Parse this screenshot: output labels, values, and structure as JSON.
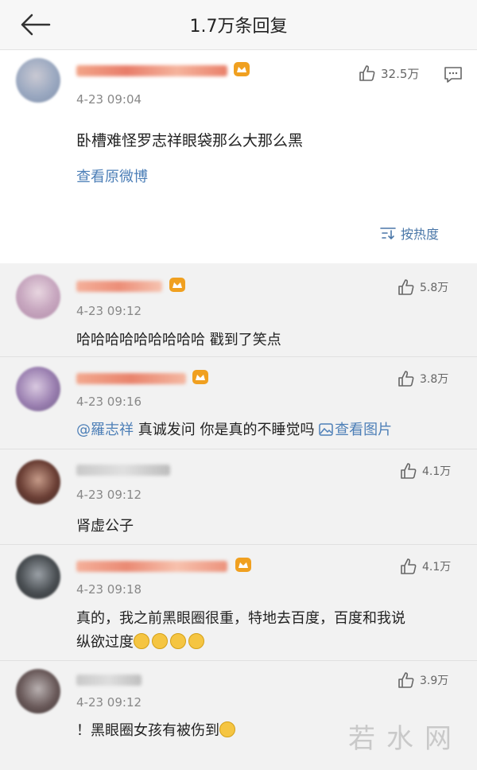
{
  "header": {
    "title": "1.7万条回复"
  },
  "main_comment": {
    "time": "4-23 09:04",
    "likes": "32.5万",
    "text": "卧槽难怪罗志祥眼袋那么大那么黑",
    "view_original": "查看原微博",
    "sort_label": "按热度"
  },
  "replies": [
    {
      "time": "4-23 09:12",
      "likes": "5.8万",
      "text": "哈哈哈哈哈哈哈哈哈 戳到了笑点"
    },
    {
      "time": "4-23 09:16",
      "likes": "3.8万",
      "mention": "@羅志祥",
      "text": " 真诚发问 你是真的不睡觉吗 ",
      "view_image": "查看图片"
    },
    {
      "time": "4-23 09:12",
      "likes": "4.1万",
      "text": "肾虚公子"
    },
    {
      "time": "4-23 09:18",
      "likes": "4.1万",
      "text": "真的，我之前黑眼圈很重，特地去百度，百度和我说",
      "text2": "纵欲过度"
    },
    {
      "time": "4-23 09:12",
      "likes": "3.9万",
      "text": "！黑眼圈女孩有被伤到"
    }
  ],
  "watermark": "若水网",
  "colors": {
    "link": "#4d7fb7",
    "vip": "#f0a020",
    "name_blur": "#f4a088"
  }
}
